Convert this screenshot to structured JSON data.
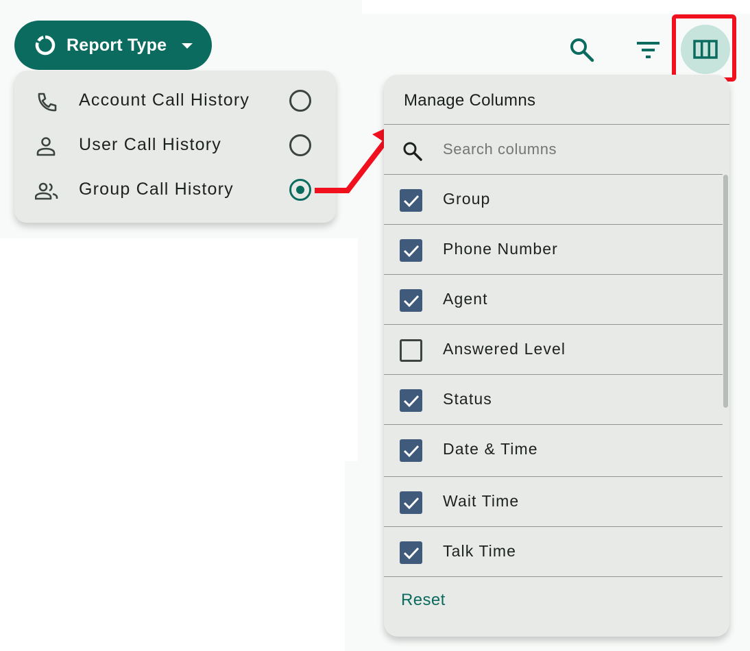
{
  "report_type": {
    "label": "Report Type",
    "options": [
      {
        "label": "Account Call History",
        "icon": "phone-icon",
        "selected": false
      },
      {
        "label": "User Call History",
        "icon": "person-icon",
        "selected": false
      },
      {
        "label": "Group Call History",
        "icon": "group-icon",
        "selected": true
      }
    ]
  },
  "toolbar": {
    "icons": [
      "search-icon",
      "filter-icon",
      "columns-icon"
    ]
  },
  "manage_columns": {
    "title": "Manage Columns",
    "search_placeholder": "Search columns",
    "columns": [
      {
        "label": "Group",
        "checked": true
      },
      {
        "label": "Phone Number",
        "checked": true
      },
      {
        "label": "Agent",
        "checked": true
      },
      {
        "label": "Answered Level",
        "checked": false
      },
      {
        "label": "Status",
        "checked": true
      },
      {
        "label": "Date & Time",
        "checked": true
      },
      {
        "label": "Wait Time",
        "checked": true
      },
      {
        "label": "Talk Time",
        "checked": true
      }
    ],
    "reset_label": "Reset"
  },
  "colors": {
    "primary": "#0c6b5f",
    "checkbox": "#3f5a7a",
    "highlight": "#f0101e",
    "menu_bg": "#e8eae7"
  }
}
